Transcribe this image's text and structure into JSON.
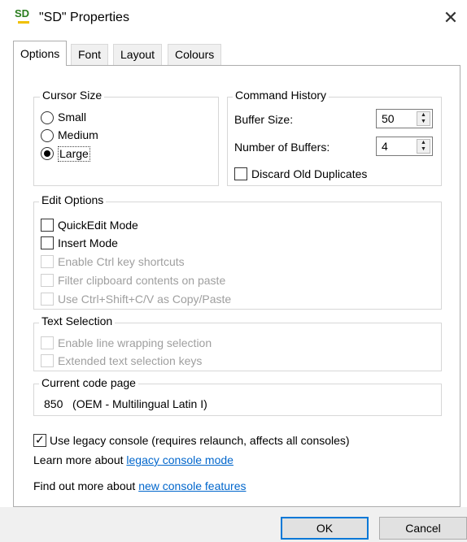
{
  "window": {
    "icon_text": "SD",
    "title": "\"SD\" Properties",
    "close_glyph": "✕"
  },
  "tabs": [
    {
      "label": "Options",
      "active": true
    },
    {
      "label": "Font",
      "active": false
    },
    {
      "label": "Layout",
      "active": false
    },
    {
      "label": "Colours",
      "active": false
    }
  ],
  "cursor_size": {
    "title": "Cursor Size",
    "options": [
      {
        "label": "Small",
        "checked": false
      },
      {
        "label": "Medium",
        "checked": false
      },
      {
        "label": "Large",
        "checked": true
      }
    ]
  },
  "command_history": {
    "title": "Command History",
    "buffer_size_label": "Buffer Size:",
    "buffer_size_value": "50",
    "num_buffers_label": "Number of Buffers:",
    "num_buffers_value": "4",
    "discard_label": "Discard Old Duplicates",
    "discard_checked": false
  },
  "edit_options": {
    "title": "Edit Options",
    "items": [
      {
        "label": "QuickEdit Mode",
        "checked": false,
        "enabled": true
      },
      {
        "label": "Insert Mode",
        "checked": false,
        "enabled": true
      },
      {
        "label": "Enable Ctrl key shortcuts",
        "checked": false,
        "enabled": false
      },
      {
        "label": "Filter clipboard contents on paste",
        "checked": false,
        "enabled": false
      },
      {
        "label": "Use Ctrl+Shift+C/V as Copy/Paste",
        "checked": false,
        "enabled": false
      }
    ]
  },
  "text_selection": {
    "title": "Text Selection",
    "items": [
      {
        "label": "Enable line wrapping selection",
        "checked": false,
        "enabled": false
      },
      {
        "label": "Extended text selection keys",
        "checked": false,
        "enabled": false
      }
    ]
  },
  "code_page": {
    "title": "Current code page",
    "value": "850   (OEM - Multilingual Latin I)"
  },
  "legacy": {
    "label": "Use legacy console (requires relaunch, affects all consoles)",
    "checked": true,
    "learn_prefix": "Learn more about ",
    "learn_link": "legacy console mode",
    "findout_prefix": "Find out more about ",
    "findout_link": "new console features"
  },
  "buttons": {
    "ok": "OK",
    "cancel": "Cancel"
  },
  "colors": {
    "link": "#0066cc",
    "default_button_border": "#0078d7"
  }
}
